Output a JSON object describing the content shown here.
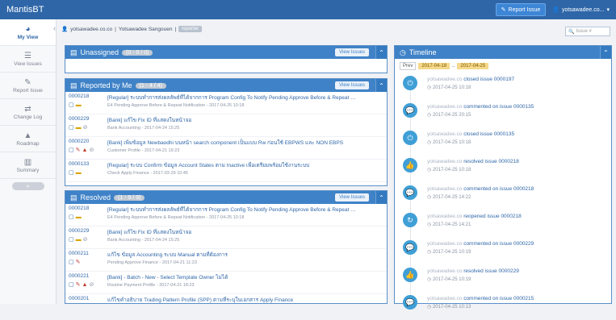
{
  "app": {
    "title": "MantisBT"
  },
  "navbar": {
    "report_issue": "Report Issue",
    "user": "yotsawadee.co..."
  },
  "sidebar": {
    "items": [
      {
        "label": "My View",
        "icon": "dashboard-icon"
      },
      {
        "label": "View Issues",
        "icon": "list-icon"
      },
      {
        "label": "Report Issue",
        "icon": "edit-icon"
      },
      {
        "label": "Change Log",
        "icon": "retweet-icon"
      },
      {
        "label": "Roadmap",
        "icon": "road-icon"
      },
      {
        "label": "Summary",
        "icon": "bar-chart-icon"
      }
    ]
  },
  "breadcrumb": {
    "user": "yotsawadee.co.co",
    "full": "Yotsawadee Sangouen",
    "badge": "reporter"
  },
  "search": {
    "placeholder": "Issue #"
  },
  "unassigned": {
    "title": "Unassigned",
    "count": "(0 - 0 / 0)",
    "view": "View Issues"
  },
  "reported": {
    "title": "Reported by Me",
    "count": "(1 - 4 / 4)",
    "view": "View Issues",
    "rows": [
      {
        "id": "0000218",
        "summary": "[Regular] ระบบทำการส่งผลลัพธ์ที่ได้จากการ Program Config To Notify Pending Approve Before & Repeat until",
        "meta": "E4 Pending Approve Before & Repeat Notification - 2017-04-25 10:18"
      },
      {
        "id": "0000229",
        "summary": "[Bank] แก้ไข Fix ID ที่แสดงในหน้าจอ",
        "meta": "Bank Accounting - 2017-04-24 15:25"
      },
      {
        "id": "0000220",
        "summary": "[Bank] เพิ่มข้อมูล Newbaodhi บนหน้า search component เป็นแบบ Rw ก่อนใช้ EBPWS และ NON EBPS",
        "meta": "Customer Profile - 2017-04-21 15:23"
      },
      {
        "id": "0000133",
        "summary": "[Regular] ระบบ Confirm ข้อมูล Account States ตาม Inactive เพื่อเตรียมพร้อมใช้งานระบบ",
        "meta": "Check Apply Finance - 2017-03-29 10:45"
      }
    ]
  },
  "resolved": {
    "title": "Resolved",
    "count": "(1 - 9 / 9)",
    "view": "View Issues",
    "rows": [
      {
        "id": "0000218",
        "summary": "[Regular] ระบบทำการส่งผลลัพธ์ที่ได้จากการ Program Config To Notify Pending Approve Before & Repeat until",
        "meta": "E4 Pending Approve Before & Repeat Notification - 2017-04-25 10:18"
      },
      {
        "id": "0000229",
        "summary": "[Bank] แก้ไข Fix ID ที่แสดงในหน้าจอ",
        "meta": "Bank Accounting - 2017-04-24 15:25"
      },
      {
        "id": "0000211",
        "summary": "แก้ไข ข้อมูล Accounting ระบบ Manual ตามที่ต้องการ",
        "meta": "Pending Approve Finance - 2017-04-21 11:23"
      },
      {
        "id": "0000221",
        "summary": "[Bank] - Batch - New - Select Template Owner ไม่ได้",
        "meta": "Routine Payment Profile - 2017-04-21 18:23"
      },
      {
        "id": "0000201",
        "summary": "แก้ไขคำอธิบาย Trading Pattern Profile (SPP) ตามที่ระบุในเอกสาร Apply Finance",
        "meta": ""
      }
    ]
  },
  "timeline": {
    "title": "Timeline",
    "prev": "Prev",
    "date_from": "2017-04-18",
    "date_to": "2017-04-25",
    "items": [
      {
        "who": "yotsawadee.co",
        "action": "closed issue 0000197",
        "time": "2017-04-25 10:18",
        "icon": "power-icon"
      },
      {
        "who": "yotsawadee.co",
        "action": "commented on issue 0000135",
        "time": "2017-04-25 20:15",
        "icon": "comment-icon"
      },
      {
        "who": "yotsawadee.co",
        "action": "closed issue 0000135",
        "time": "2017-04-25 10:18",
        "icon": "power-icon"
      },
      {
        "who": "yotsawadee.co",
        "action": "resolved issue 0000218",
        "time": "2017-04-25 10:18",
        "icon": "thumbs-up-icon"
      },
      {
        "who": "yotsawadee.co",
        "action": "commented on issue 0000218",
        "time": "2017-04-25 14:22",
        "icon": "comment-icon"
      },
      {
        "who": "yotsawadee.co",
        "action": "reopened issue 0000218",
        "time": "2017-04-25 14:21",
        "icon": "refresh-icon"
      },
      {
        "who": "yotsawadee.co",
        "action": "commented on issue 0000229",
        "time": "2017-04-25 10:19",
        "icon": "comment-icon"
      },
      {
        "who": "yotsawadee.co",
        "action": "resolved issue 0000229",
        "time": "2017-04-25 10:19",
        "icon": "thumbs-up-icon"
      },
      {
        "who": "yotsawadee.co",
        "action": "commented on issue 0000215",
        "time": "2017-04-25 10:13",
        "icon": "comment-icon"
      }
    ]
  },
  "colors": {
    "navbar": "#2e66a8",
    "box_header": "#3f82c7",
    "timeline_circle": "#3f9fd6"
  }
}
